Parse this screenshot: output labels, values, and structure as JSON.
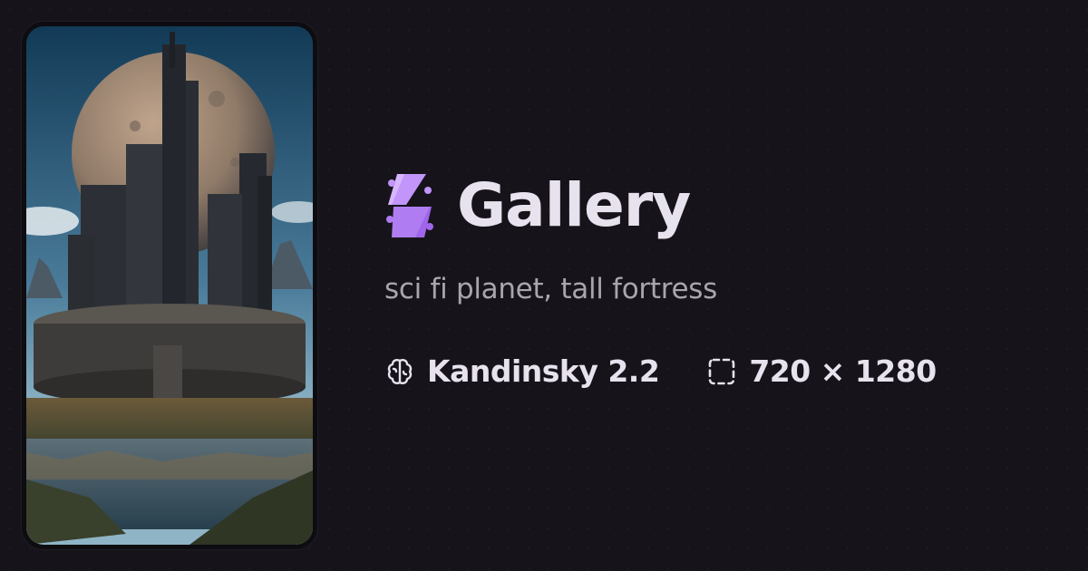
{
  "preview": {
    "alt": "sci fi planet, tall fortress"
  },
  "brand": {
    "name": "Gallery",
    "logo_icon": "gallery-logo-icon"
  },
  "prompt": "sci fi planet, tall fortress",
  "meta": {
    "model": {
      "label": "Kandinsky 2.2",
      "icon": "brain-icon"
    },
    "dimensions": {
      "label": "720 × 1280",
      "icon": "dashed-frame-icon"
    }
  },
  "colors": {
    "background": "#16141a",
    "card": "#0d0c10",
    "logo_accent": "#b07cf2",
    "title": "#e7e2ee",
    "prompt": "#a8a5ad"
  }
}
